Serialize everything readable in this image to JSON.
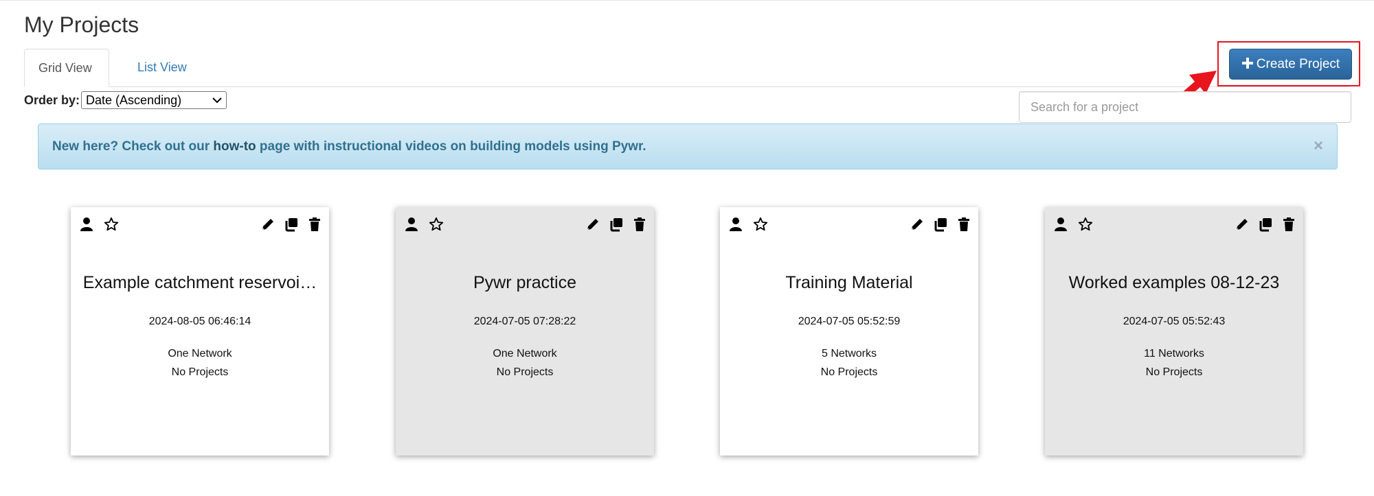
{
  "page": {
    "title": "My Projects"
  },
  "tabs": [
    {
      "label": "Grid View",
      "active": true
    },
    {
      "label": "List View",
      "active": false
    }
  ],
  "order_by": {
    "label": "Order by:",
    "selected": "Date (Ascending)"
  },
  "create_button": {
    "label": "Create Project",
    "icon": "plus-icon"
  },
  "search": {
    "placeholder": "Search for a project"
  },
  "alert": {
    "prefix": "New here? Check out our ",
    "link_text": "how-to",
    "suffix": " page with instructional videos on building models using Pywr.",
    "close": "×"
  },
  "colors": {
    "primary_button": "#2e6da4",
    "alert_bg": "#d9edf7",
    "highlight_box": "#e8141e",
    "arrow": "#e8141e",
    "card_grey": "#e6e6e6"
  },
  "projects": [
    {
      "title": "Example catchment reservoi…",
      "date": "2024-08-05 06:46:14",
      "networks": "One Network",
      "subprojects": "No Projects",
      "theme": "white"
    },
    {
      "title": "Pywr practice",
      "date": "2024-07-05 07:28:22",
      "networks": "One Network",
      "subprojects": "No Projects",
      "theme": "grey"
    },
    {
      "title": "Training Material",
      "date": "2024-07-05 05:52:59",
      "networks": "5 Networks",
      "subprojects": "No Projects",
      "theme": "white"
    },
    {
      "title": "Worked examples 08-12-23",
      "date": "2024-07-05 05:52:43",
      "networks": "11 Networks",
      "subprojects": "No Projects",
      "theme": "grey"
    }
  ]
}
